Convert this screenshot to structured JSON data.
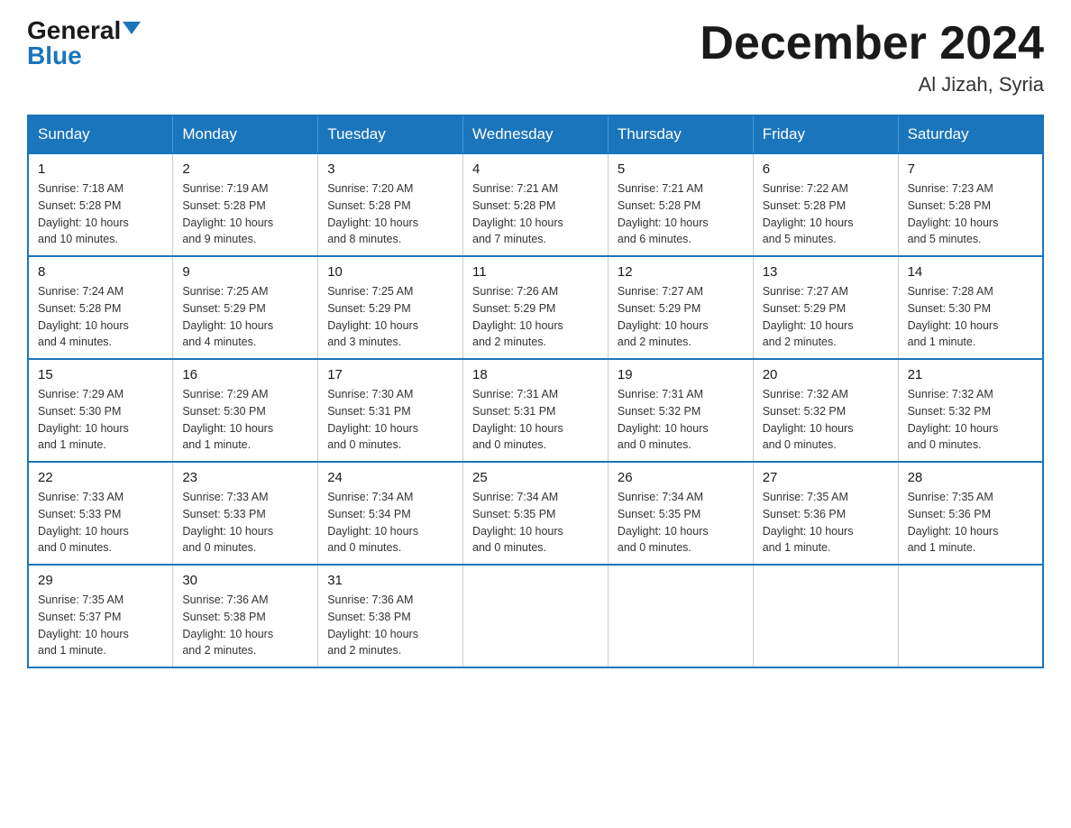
{
  "header": {
    "logo_general": "General",
    "logo_blue": "Blue",
    "title": "December 2024",
    "subtitle": "Al Jizah, Syria"
  },
  "weekdays": [
    "Sunday",
    "Monday",
    "Tuesday",
    "Wednesday",
    "Thursday",
    "Friday",
    "Saturday"
  ],
  "weeks": [
    [
      {
        "day": "1",
        "sunrise": "7:18 AM",
        "sunset": "5:28 PM",
        "daylight": "10 hours and 10 minutes."
      },
      {
        "day": "2",
        "sunrise": "7:19 AM",
        "sunset": "5:28 PM",
        "daylight": "10 hours and 9 minutes."
      },
      {
        "day": "3",
        "sunrise": "7:20 AM",
        "sunset": "5:28 PM",
        "daylight": "10 hours and 8 minutes."
      },
      {
        "day": "4",
        "sunrise": "7:21 AM",
        "sunset": "5:28 PM",
        "daylight": "10 hours and 7 minutes."
      },
      {
        "day": "5",
        "sunrise": "7:21 AM",
        "sunset": "5:28 PM",
        "daylight": "10 hours and 6 minutes."
      },
      {
        "day": "6",
        "sunrise": "7:22 AM",
        "sunset": "5:28 PM",
        "daylight": "10 hours and 5 minutes."
      },
      {
        "day": "7",
        "sunrise": "7:23 AM",
        "sunset": "5:28 PM",
        "daylight": "10 hours and 5 minutes."
      }
    ],
    [
      {
        "day": "8",
        "sunrise": "7:24 AM",
        "sunset": "5:28 PM",
        "daylight": "10 hours and 4 minutes."
      },
      {
        "day": "9",
        "sunrise": "7:25 AM",
        "sunset": "5:29 PM",
        "daylight": "10 hours and 4 minutes."
      },
      {
        "day": "10",
        "sunrise": "7:25 AM",
        "sunset": "5:29 PM",
        "daylight": "10 hours and 3 minutes."
      },
      {
        "day": "11",
        "sunrise": "7:26 AM",
        "sunset": "5:29 PM",
        "daylight": "10 hours and 2 minutes."
      },
      {
        "day": "12",
        "sunrise": "7:27 AM",
        "sunset": "5:29 PM",
        "daylight": "10 hours and 2 minutes."
      },
      {
        "day": "13",
        "sunrise": "7:27 AM",
        "sunset": "5:29 PM",
        "daylight": "10 hours and 2 minutes."
      },
      {
        "day": "14",
        "sunrise": "7:28 AM",
        "sunset": "5:30 PM",
        "daylight": "10 hours and 1 minute."
      }
    ],
    [
      {
        "day": "15",
        "sunrise": "7:29 AM",
        "sunset": "5:30 PM",
        "daylight": "10 hours and 1 minute."
      },
      {
        "day": "16",
        "sunrise": "7:29 AM",
        "sunset": "5:30 PM",
        "daylight": "10 hours and 1 minute."
      },
      {
        "day": "17",
        "sunrise": "7:30 AM",
        "sunset": "5:31 PM",
        "daylight": "10 hours and 0 minutes."
      },
      {
        "day": "18",
        "sunrise": "7:31 AM",
        "sunset": "5:31 PM",
        "daylight": "10 hours and 0 minutes."
      },
      {
        "day": "19",
        "sunrise": "7:31 AM",
        "sunset": "5:32 PM",
        "daylight": "10 hours and 0 minutes."
      },
      {
        "day": "20",
        "sunrise": "7:32 AM",
        "sunset": "5:32 PM",
        "daylight": "10 hours and 0 minutes."
      },
      {
        "day": "21",
        "sunrise": "7:32 AM",
        "sunset": "5:32 PM",
        "daylight": "10 hours and 0 minutes."
      }
    ],
    [
      {
        "day": "22",
        "sunrise": "7:33 AM",
        "sunset": "5:33 PM",
        "daylight": "10 hours and 0 minutes."
      },
      {
        "day": "23",
        "sunrise": "7:33 AM",
        "sunset": "5:33 PM",
        "daylight": "10 hours and 0 minutes."
      },
      {
        "day": "24",
        "sunrise": "7:34 AM",
        "sunset": "5:34 PM",
        "daylight": "10 hours and 0 minutes."
      },
      {
        "day": "25",
        "sunrise": "7:34 AM",
        "sunset": "5:35 PM",
        "daylight": "10 hours and 0 minutes."
      },
      {
        "day": "26",
        "sunrise": "7:34 AM",
        "sunset": "5:35 PM",
        "daylight": "10 hours and 0 minutes."
      },
      {
        "day": "27",
        "sunrise": "7:35 AM",
        "sunset": "5:36 PM",
        "daylight": "10 hours and 1 minute."
      },
      {
        "day": "28",
        "sunrise": "7:35 AM",
        "sunset": "5:36 PM",
        "daylight": "10 hours and 1 minute."
      }
    ],
    [
      {
        "day": "29",
        "sunrise": "7:35 AM",
        "sunset": "5:37 PM",
        "daylight": "10 hours and 1 minute."
      },
      {
        "day": "30",
        "sunrise": "7:36 AM",
        "sunset": "5:38 PM",
        "daylight": "10 hours and 2 minutes."
      },
      {
        "day": "31",
        "sunrise": "7:36 AM",
        "sunset": "5:38 PM",
        "daylight": "10 hours and 2 minutes."
      },
      null,
      null,
      null,
      null
    ]
  ],
  "labels": {
    "sunrise": "Sunrise:",
    "sunset": "Sunset:",
    "daylight": "Daylight:"
  }
}
